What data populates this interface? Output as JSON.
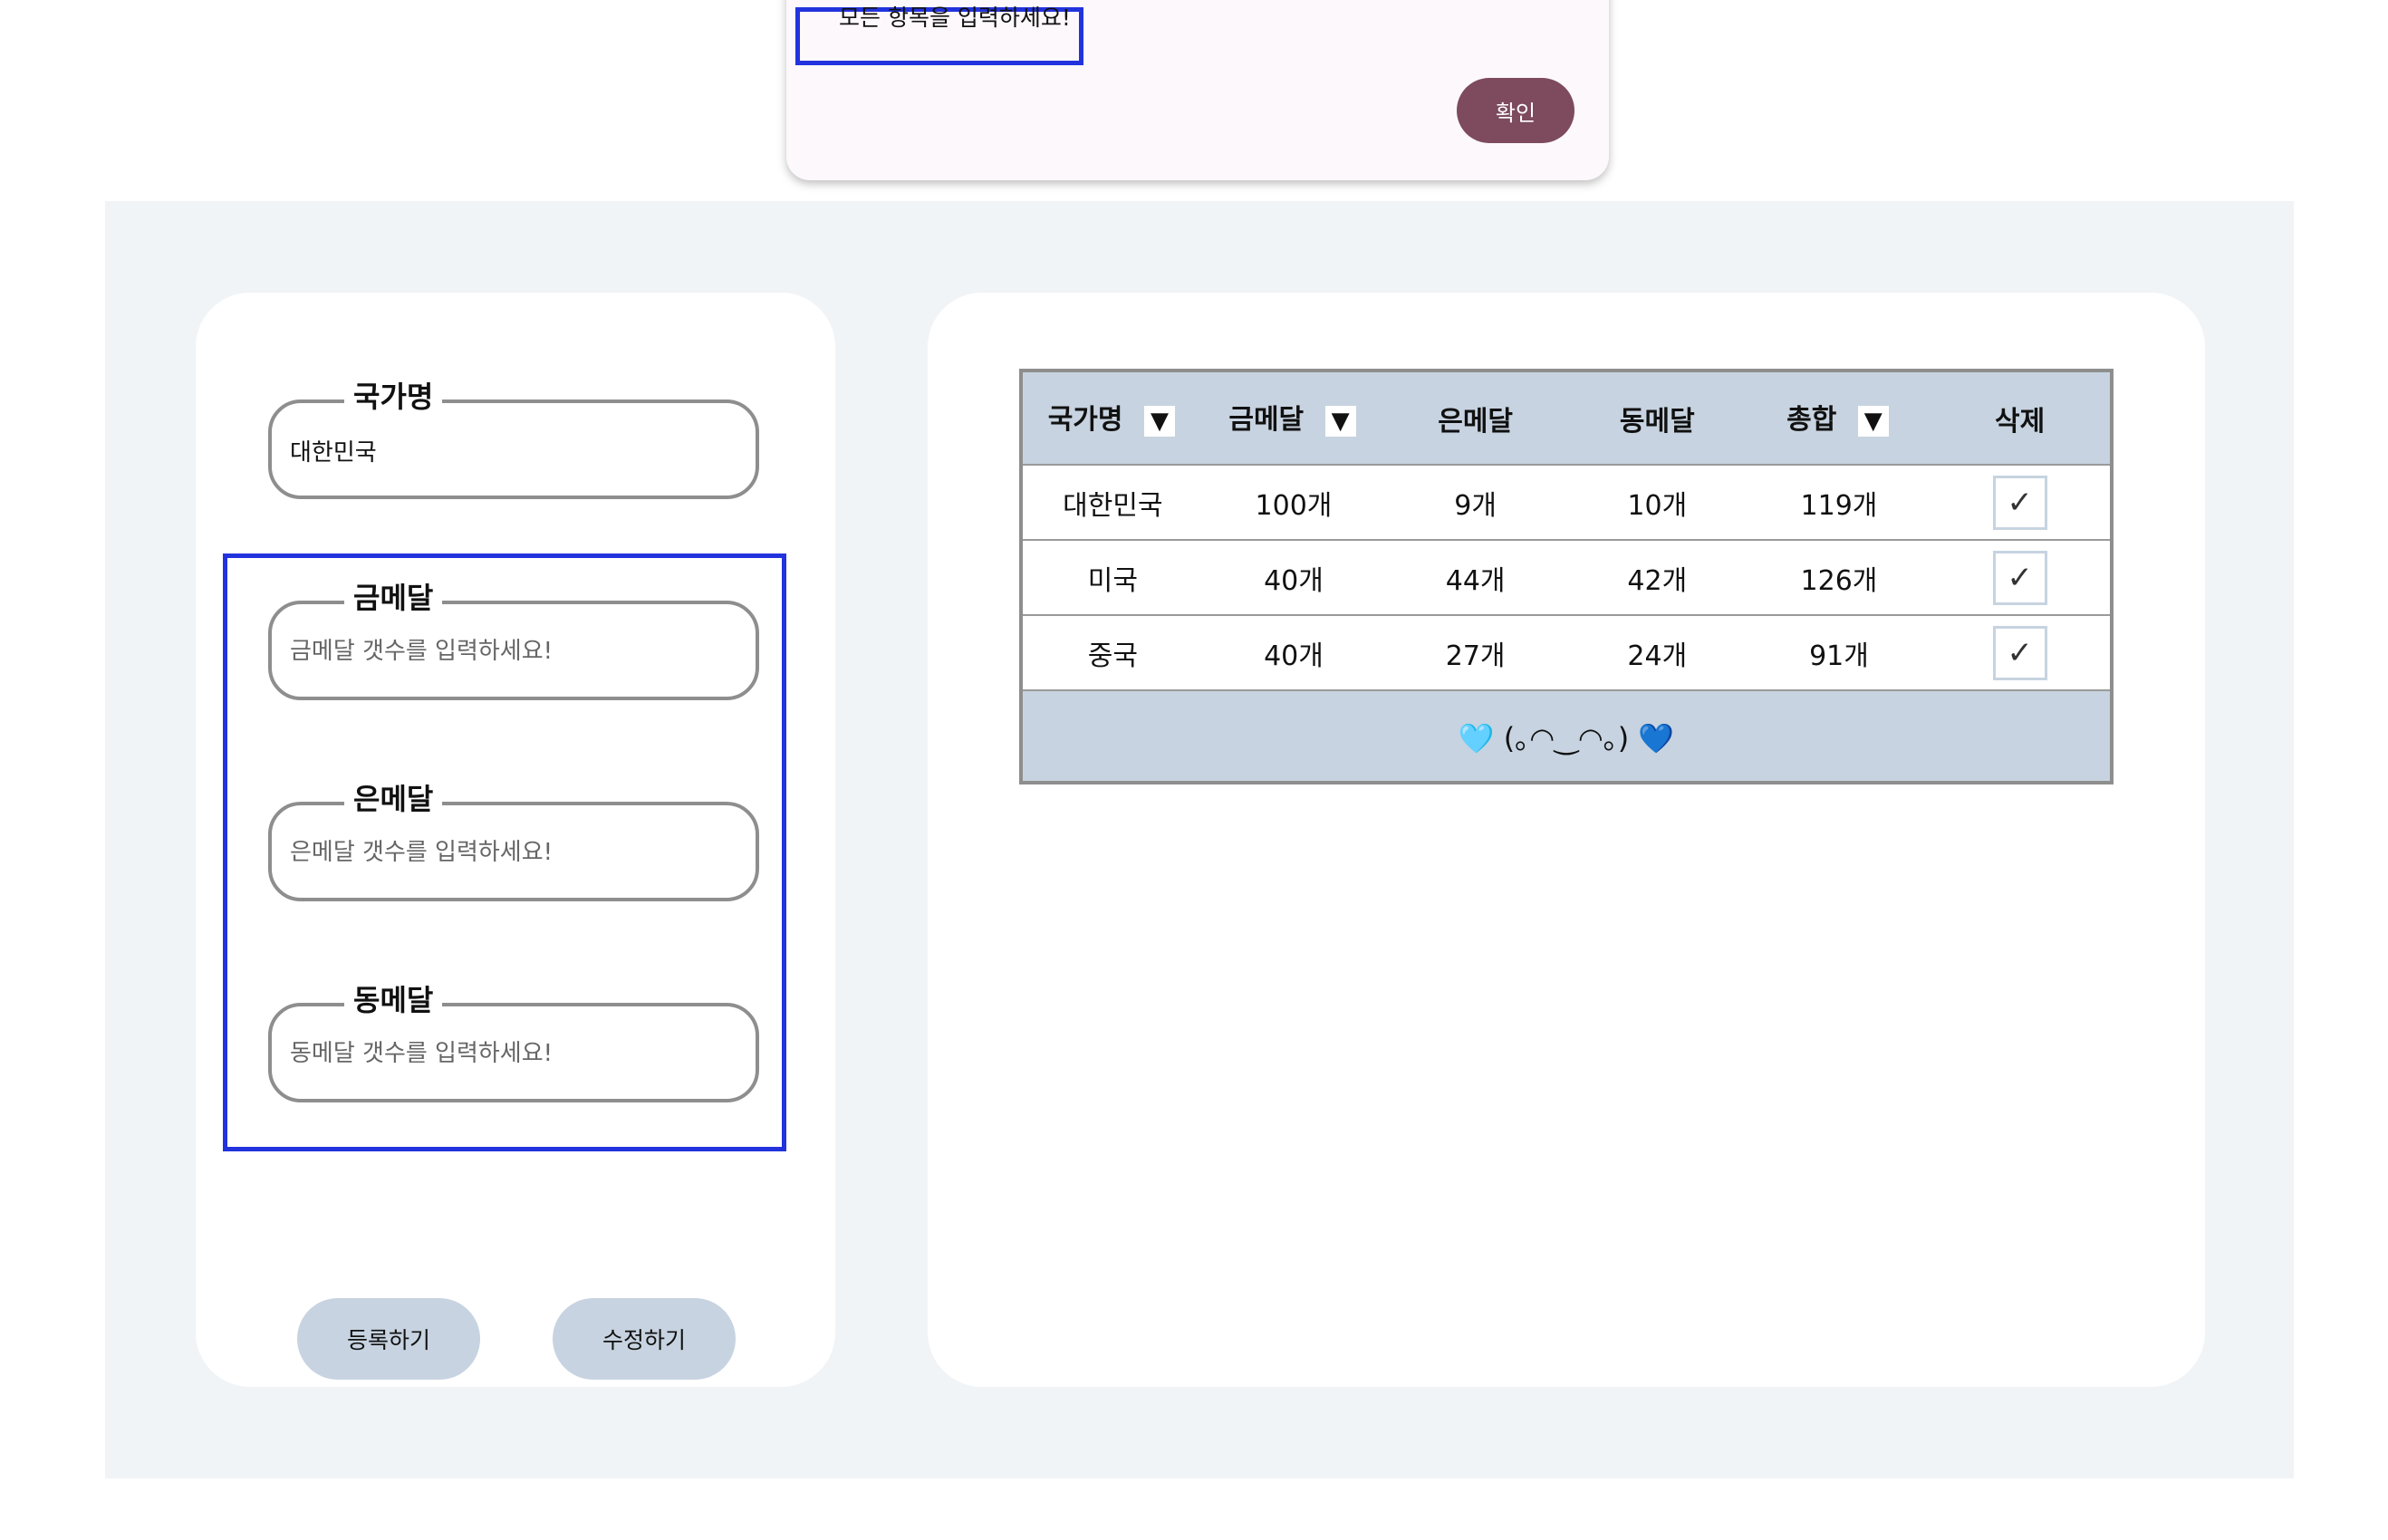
{
  "dialog": {
    "message": "모든 항목을 입력하세요!",
    "ok_label": "확인"
  },
  "form": {
    "country": {
      "legend": "국가명",
      "value": "대한민국",
      "placeholder": ""
    },
    "gold": {
      "legend": "금메달",
      "value": "",
      "placeholder": "금메달 갯수를 입력하세요!"
    },
    "silver": {
      "legend": "은메달",
      "value": "",
      "placeholder": "은메달 갯수를 입력하세요!"
    },
    "bronze": {
      "legend": "동메달",
      "value": "",
      "placeholder": "동메달 갯수를 입력하세요!"
    },
    "register_label": "등록하기",
    "edit_label": "수정하기"
  },
  "table": {
    "headers": {
      "country": "국가명",
      "gold": "금메달",
      "silver": "은메달",
      "bronze": "동메달",
      "total": "총합",
      "delete": "삭제"
    },
    "sort_glyph": "▼",
    "check_glyph": "✓",
    "rows": [
      {
        "country": "대한민국",
        "gold": "100개",
        "silver": "9개",
        "bronze": "10개",
        "total": "119개"
      },
      {
        "country": "미국",
        "gold": "40개",
        "silver": "44개",
        "bronze": "42개",
        "total": "126개"
      },
      {
        "country": "중국",
        "gold": "40개",
        "silver": "27개",
        "bronze": "24개",
        "total": "91개"
      }
    ],
    "footer": "🩵 (｡◠‿◠｡) 💙"
  },
  "colors": {
    "accent": "#7d4a5e",
    "highlight": "#2233dd",
    "table_header_bg": "#c7d3e0",
    "app_bg": "#f0f4f7"
  }
}
